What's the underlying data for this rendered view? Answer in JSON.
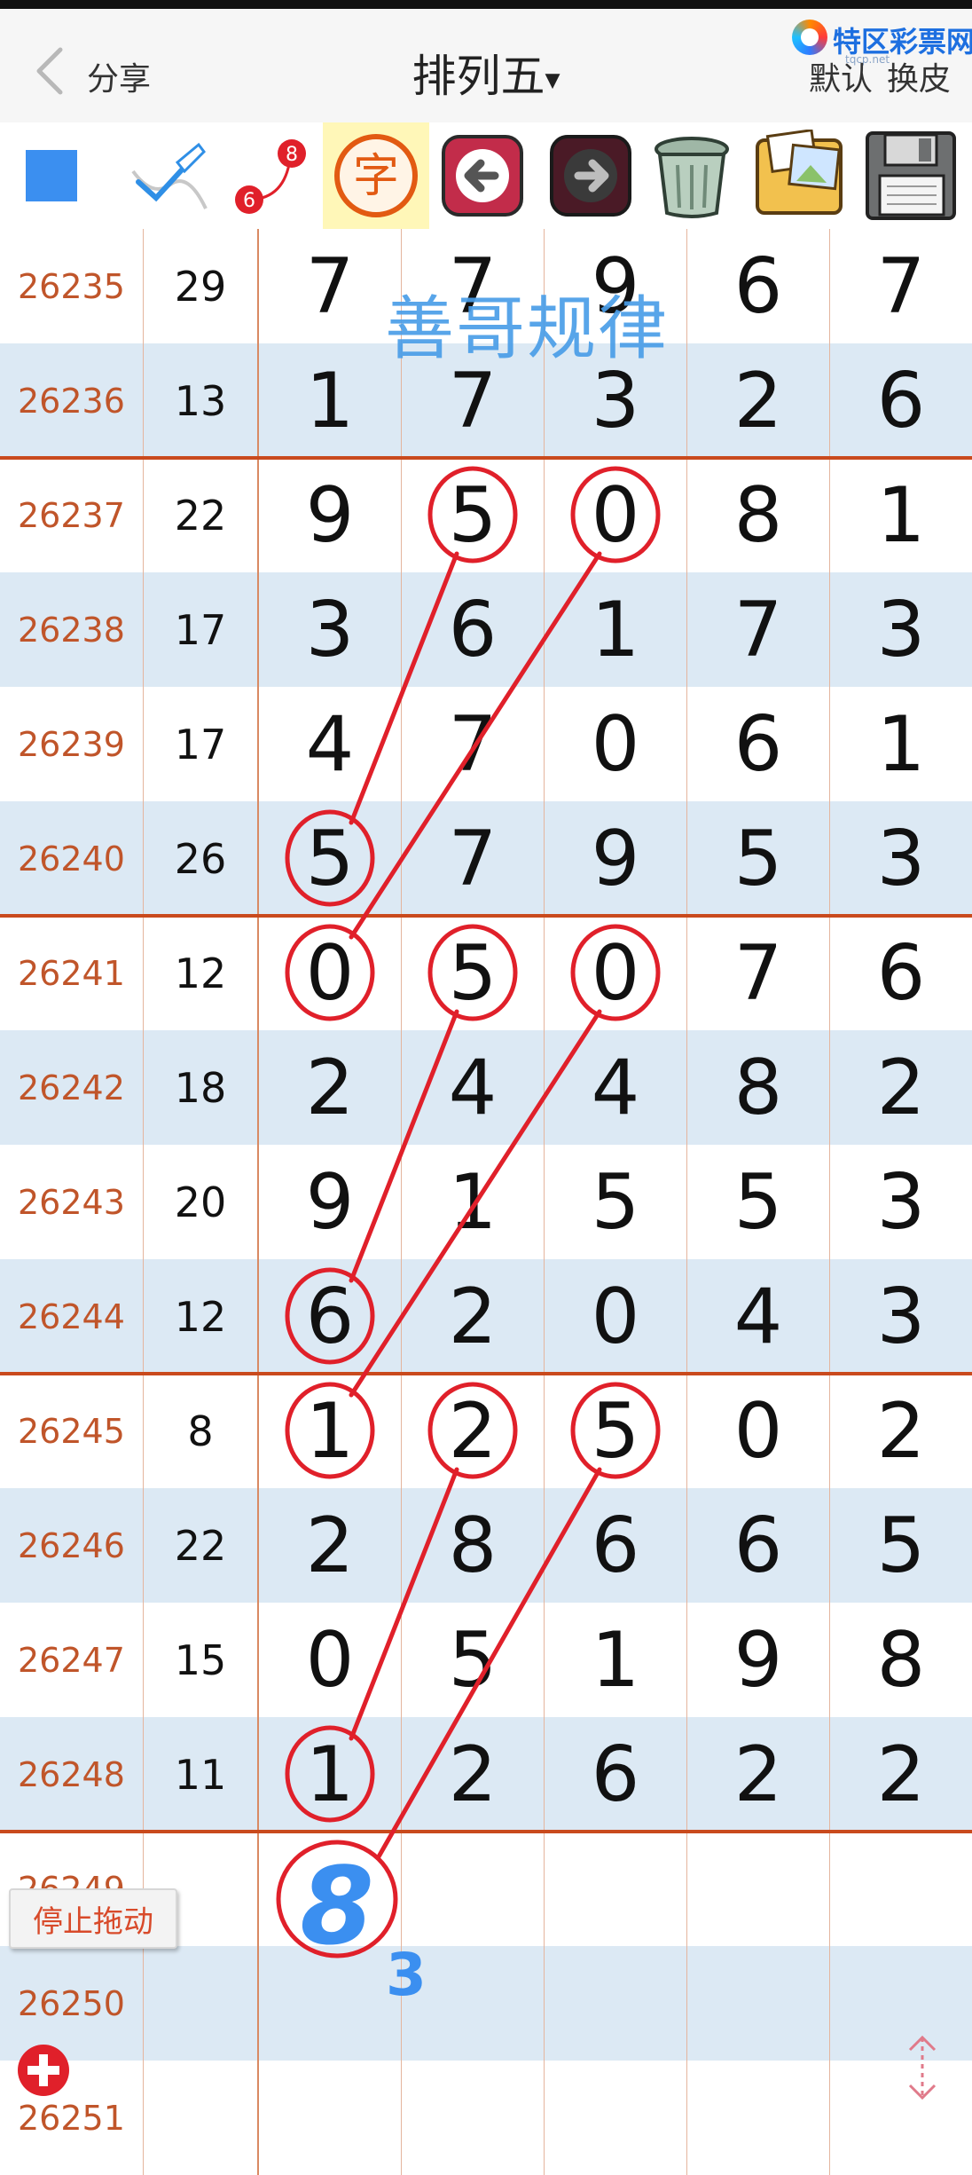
{
  "header": {
    "share_label": "分享",
    "title": "排列五",
    "title_caret": "▾",
    "default_label": "默认",
    "skin_label": "换皮",
    "logo_text": "特区彩票网",
    "logo_sub": "tqcp.net"
  },
  "toolbar": {
    "icons": [
      "color-square-icon",
      "pen-icon",
      "connect-line-icon",
      "char-icon",
      "undo-icon",
      "redo-icon",
      "trash-icon",
      "photo-album-icon",
      "save-disk-icon"
    ],
    "char_label": "字",
    "connect_numbers": [
      "8",
      "6"
    ],
    "accent": "#3b8ff0"
  },
  "watermark": "善哥规律",
  "colors": {
    "issue": "#c0552a",
    "row_alt": "#dce9f4",
    "group_line": "#c94a1d",
    "marker": "#e0202a",
    "blue_ink": "#3b8ff0"
  },
  "rows": [
    {
      "issue": "26235",
      "sum": "29",
      "d": [
        "7",
        "7",
        "9",
        "6",
        "7"
      ]
    },
    {
      "issue": "26236",
      "sum": "13",
      "d": [
        "1",
        "7",
        "3",
        "2",
        "6"
      ]
    },
    {
      "issue": "26237",
      "sum": "22",
      "d": [
        "9",
        "5",
        "0",
        "8",
        "1"
      ]
    },
    {
      "issue": "26238",
      "sum": "17",
      "d": [
        "3",
        "6",
        "1",
        "7",
        "3"
      ]
    },
    {
      "issue": "26239",
      "sum": "17",
      "d": [
        "4",
        "7",
        "0",
        "6",
        "1"
      ]
    },
    {
      "issue": "26240",
      "sum": "26",
      "d": [
        "5",
        "7",
        "9",
        "5",
        "3"
      ]
    },
    {
      "issue": "26241",
      "sum": "12",
      "d": [
        "0",
        "5",
        "0",
        "7",
        "6"
      ]
    },
    {
      "issue": "26242",
      "sum": "18",
      "d": [
        "2",
        "4",
        "4",
        "8",
        "2"
      ]
    },
    {
      "issue": "26243",
      "sum": "20",
      "d": [
        "9",
        "1",
        "5",
        "5",
        "3"
      ]
    },
    {
      "issue": "26244",
      "sum": "12",
      "d": [
        "6",
        "2",
        "0",
        "4",
        "3"
      ]
    },
    {
      "issue": "26245",
      "sum": "8",
      "d": [
        "1",
        "2",
        "5",
        "0",
        "2"
      ]
    },
    {
      "issue": "26246",
      "sum": "22",
      "d": [
        "2",
        "8",
        "6",
        "6",
        "5"
      ]
    },
    {
      "issue": "26247",
      "sum": "15",
      "d": [
        "0",
        "5",
        "1",
        "9",
        "8"
      ]
    },
    {
      "issue": "26248",
      "sum": "11",
      "d": [
        "1",
        "2",
        "6",
        "2",
        "2"
      ]
    },
    {
      "issue": "26249",
      "sum": "",
      "d": [
        "",
        "",
        "",
        "",
        ""
      ]
    },
    {
      "issue": "26250",
      "sum": "",
      "d": [
        "",
        "",
        "",
        "",
        ""
      ]
    },
    {
      "issue": "26251",
      "sum": "",
      "d": [
        "",
        "",
        "",
        "",
        ""
      ]
    }
  ],
  "annotation": {
    "predicted_digit": "8",
    "small_mark": "3"
  },
  "stop_drag_label": "停止拖动"
}
